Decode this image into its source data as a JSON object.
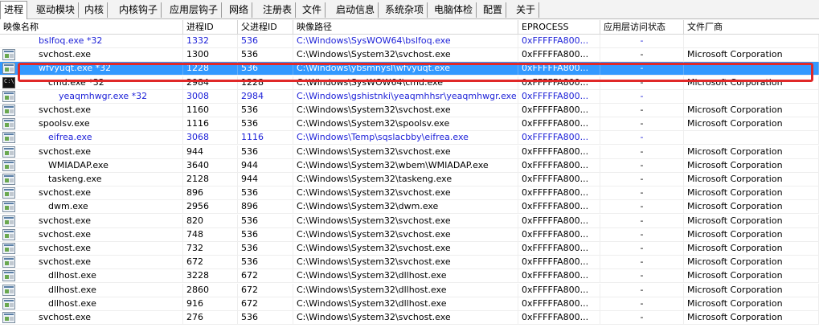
{
  "tabs": [
    "进程",
    "驱动模块",
    "内核",
    "内核钩子",
    "应用层钩子",
    "网络",
    "注册表",
    "文件",
    "启动信息",
    "系统杂项",
    "电脑体检",
    "配置",
    "关于"
  ],
  "columns": [
    "映像名称",
    "进程ID",
    "父进程ID",
    "映像路径",
    "EPROCESS",
    "应用层访问状态",
    "文件厂商"
  ],
  "rows": [
    {
      "name": "bslfoq.exe *32",
      "pid": "1332",
      "ppid": "536",
      "path": "C:\\Windows\\SysWOW64\\bslfoq.exe",
      "eprocess": "0xFFFFFA800...",
      "access": "-",
      "vendor": "",
      "icon": "none",
      "indent": 1,
      "blue": true
    },
    {
      "name": "svchost.exe",
      "pid": "1300",
      "ppid": "536",
      "path": "C:\\Windows\\System32\\svchost.exe",
      "eprocess": "0xFFFFFA800...",
      "access": "-",
      "vendor": "Microsoft Corporation",
      "icon": "window",
      "indent": 1,
      "blue": false
    },
    {
      "name": "wfvyuqt.exe *32",
      "pid": "1228",
      "ppid": "536",
      "path": "C:\\Windows\\ybsmnysl\\wfvyuqt.exe",
      "eprocess": "0xFFFFFA800...",
      "access": "-",
      "vendor": "",
      "icon": "window",
      "indent": 1,
      "blue": true,
      "selected": true
    },
    {
      "name": "cmd.exe *32",
      "pid": "2984",
      "ppid": "1228",
      "path": "C:\\Windows\\SysWOW64\\cmd.exe",
      "eprocess": "0xFFFFFA800...",
      "access": "-",
      "vendor": "Microsoft Corporation",
      "icon": "cmd",
      "indent": 2,
      "blue": false
    },
    {
      "name": "yeaqmhwgr.exe *32",
      "pid": "3008",
      "ppid": "2984",
      "path": "C:\\Windows\\gshistnki\\yeaqmhhsr\\yeaqmhwgr.exe",
      "eprocess": "0xFFFFFA800...",
      "access": "-",
      "vendor": "",
      "icon": "window",
      "indent": 3,
      "blue": true
    },
    {
      "name": "svchost.exe",
      "pid": "1160",
      "ppid": "536",
      "path": "C:\\Windows\\System32\\svchost.exe",
      "eprocess": "0xFFFFFA800...",
      "access": "-",
      "vendor": "Microsoft Corporation",
      "icon": "window",
      "indent": 1,
      "blue": false
    },
    {
      "name": "spoolsv.exe",
      "pid": "1116",
      "ppid": "536",
      "path": "C:\\Windows\\System32\\spoolsv.exe",
      "eprocess": "0xFFFFFA800...",
      "access": "-",
      "vendor": "Microsoft Corporation",
      "icon": "window",
      "indent": 1,
      "blue": false
    },
    {
      "name": "eifrea.exe",
      "pid": "3068",
      "ppid": "1116",
      "path": "C:\\Windows\\Temp\\sqslacbby\\eifrea.exe",
      "eprocess": "0xFFFFFA800...",
      "access": "-",
      "vendor": "",
      "icon": "window",
      "indent": 2,
      "blue": true
    },
    {
      "name": "svchost.exe",
      "pid": "944",
      "ppid": "536",
      "path": "C:\\Windows\\System32\\svchost.exe",
      "eprocess": "0xFFFFFA800...",
      "access": "-",
      "vendor": "Microsoft Corporation",
      "icon": "window",
      "indent": 1,
      "blue": false
    },
    {
      "name": "WMIADAP.exe",
      "pid": "3640",
      "ppid": "944",
      "path": "C:\\Windows\\System32\\wbem\\WMIADAP.exe",
      "eprocess": "0xFFFFFA800...",
      "access": "-",
      "vendor": "Microsoft Corporation",
      "icon": "window",
      "indent": 2,
      "blue": false
    },
    {
      "name": "taskeng.exe",
      "pid": "2128",
      "ppid": "944",
      "path": "C:\\Windows\\System32\\taskeng.exe",
      "eprocess": "0xFFFFFA800...",
      "access": "-",
      "vendor": "Microsoft Corporation",
      "icon": "window",
      "indent": 2,
      "blue": false
    },
    {
      "name": "svchost.exe",
      "pid": "896",
      "ppid": "536",
      "path": "C:\\Windows\\System32\\svchost.exe",
      "eprocess": "0xFFFFFA800...",
      "access": "-",
      "vendor": "Microsoft Corporation",
      "icon": "window",
      "indent": 1,
      "blue": false
    },
    {
      "name": "dwm.exe",
      "pid": "2956",
      "ppid": "896",
      "path": "C:\\Windows\\System32\\dwm.exe",
      "eprocess": "0xFFFFFA800...",
      "access": "-",
      "vendor": "Microsoft Corporation",
      "icon": "window",
      "indent": 2,
      "blue": false
    },
    {
      "name": "svchost.exe",
      "pid": "820",
      "ppid": "536",
      "path": "C:\\Windows\\System32\\svchost.exe",
      "eprocess": "0xFFFFFA800...",
      "access": "-",
      "vendor": "Microsoft Corporation",
      "icon": "window",
      "indent": 1,
      "blue": false
    },
    {
      "name": "svchost.exe",
      "pid": "748",
      "ppid": "536",
      "path": "C:\\Windows\\System32\\svchost.exe",
      "eprocess": "0xFFFFFA800...",
      "access": "-",
      "vendor": "Microsoft Corporation",
      "icon": "window",
      "indent": 1,
      "blue": false
    },
    {
      "name": "svchost.exe",
      "pid": "732",
      "ppid": "536",
      "path": "C:\\Windows\\System32\\svchost.exe",
      "eprocess": "0xFFFFFA800...",
      "access": "-",
      "vendor": "Microsoft Corporation",
      "icon": "window",
      "indent": 1,
      "blue": false
    },
    {
      "name": "svchost.exe",
      "pid": "672",
      "ppid": "536",
      "path": "C:\\Windows\\System32\\svchost.exe",
      "eprocess": "0xFFFFFA800...",
      "access": "-",
      "vendor": "Microsoft Corporation",
      "icon": "window",
      "indent": 1,
      "blue": false
    },
    {
      "name": "dllhost.exe",
      "pid": "3228",
      "ppid": "672",
      "path": "C:\\Windows\\System32\\dllhost.exe",
      "eprocess": "0xFFFFFA800...",
      "access": "-",
      "vendor": "Microsoft Corporation",
      "icon": "window",
      "indent": 2,
      "blue": false
    },
    {
      "name": "dllhost.exe",
      "pid": "2860",
      "ppid": "672",
      "path": "C:\\Windows\\System32\\dllhost.exe",
      "eprocess": "0xFFFFFA800...",
      "access": "-",
      "vendor": "Microsoft Corporation",
      "icon": "window",
      "indent": 2,
      "blue": false
    },
    {
      "name": "dllhost.exe",
      "pid": "916",
      "ppid": "672",
      "path": "C:\\Windows\\System32\\dllhost.exe",
      "eprocess": "0xFFFFFA800...",
      "access": "-",
      "vendor": "Microsoft Corporation",
      "icon": "window",
      "indent": 2,
      "blue": false
    },
    {
      "name": "svchost.exe",
      "pid": "276",
      "ppid": "536",
      "path": "C:\\Windows\\System32\\svchost.exe",
      "eprocess": "0xFFFFFA800...",
      "access": "-",
      "vendor": "Microsoft Corporation",
      "icon": "window",
      "indent": 1,
      "blue": false
    }
  ],
  "colors": {
    "selected_bg": "#3399ff",
    "highlight_border": "#e02828",
    "unsigned_text": "#1e22d8"
  }
}
